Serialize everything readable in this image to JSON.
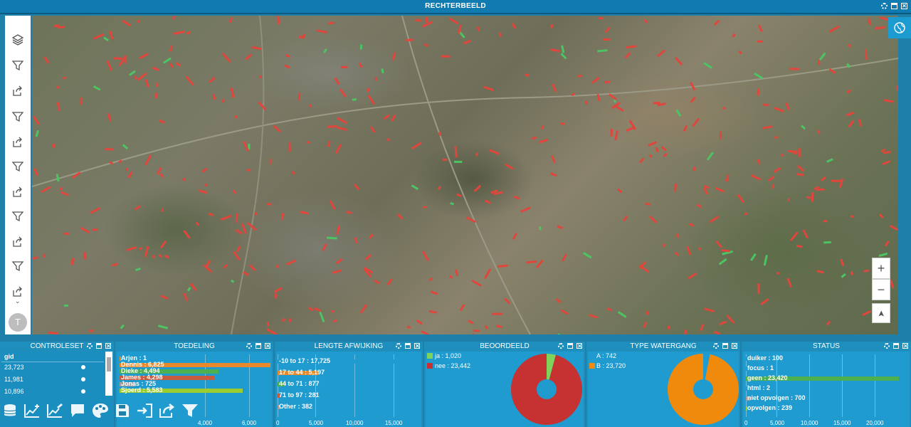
{
  "window": {
    "title": "RECHTERBEELD"
  },
  "sidebar": {
    "avatar_initial": "T"
  },
  "map": {
    "zoom_in": "+",
    "zoom_out": "−",
    "north": "➤"
  },
  "panels": {
    "controleset": {
      "title": "CONTROLESET",
      "column": "gid",
      "rows": [
        "23,723",
        "11,981",
        "10,896"
      ]
    },
    "toedeling": {
      "title": "TOEDELING",
      "rows": [
        {
          "label": "Arjen : 1",
          "value": 1,
          "color": "#e8892b"
        },
        {
          "label": "Dennis : 6,825",
          "value": 6825,
          "color": "#e8892b"
        },
        {
          "label": "Dieke : 4,494",
          "value": 4494,
          "color": "#4caf50"
        },
        {
          "label": "James : 4,298",
          "value": 4298,
          "color": "#c75b3f"
        },
        {
          "label": "Jonas : 725",
          "value": 725,
          "color": "#9e9e9e"
        },
        {
          "label": "Sjoerd : 5,583",
          "value": 5583,
          "color": "#9ccc2f"
        }
      ],
      "ticks": [
        "4,000",
        "6,000"
      ]
    },
    "lengte": {
      "title": "LENGTE AFWIJKING",
      "rows": [
        {
          "label": "-10 to 17 : 17,725",
          "value": 17725,
          "color": "#1f9bcf"
        },
        {
          "label": "17 to 44 : 5,197",
          "value": 5197,
          "color": "#e8892b"
        },
        {
          "label": "44 to 71 : 877",
          "value": 877,
          "color": "#4caf50"
        },
        {
          "label": "71 to 97 : 281",
          "value": 281,
          "color": "#c75b3f"
        },
        {
          "label": "Other : 382",
          "value": 382,
          "color": "#9e9e9e"
        }
      ],
      "ticks": [
        "0",
        "5,000",
        "10,000",
        "15,000"
      ]
    },
    "beoordeeld": {
      "title": "BEOORDEELD",
      "legend": [
        {
          "label": "ja : 1,020",
          "value": 1020,
          "color": "#7fd35a"
        },
        {
          "label": "nee : 23,442",
          "value": 23442,
          "color": "#c63232"
        }
      ]
    },
    "type": {
      "title": "TYPE WATERGANG",
      "legend": [
        {
          "label": "A : 742",
          "value": 742,
          "color": "#1f9bcf"
        },
        {
          "label": "B : 23,720",
          "value": 23720,
          "color": "#f08a0c"
        }
      ]
    },
    "status": {
      "title": "STATUS",
      "rows": [
        {
          "label": "duiker : 100",
          "value": 100,
          "color": "#1f9bcf"
        },
        {
          "label": "focus : 1",
          "value": 1,
          "color": "#1f9bcf"
        },
        {
          "label": "geen : 23,420",
          "value": 23420,
          "color": "#4caf50"
        },
        {
          "label": "html : 2",
          "value": 2,
          "color": "#1f9bcf"
        },
        {
          "label": "niet opvolgen : 700",
          "value": 700,
          "color": "#9e9e9e"
        },
        {
          "label": "opvolgen : 239",
          "value": 239,
          "color": "#9ccc2f"
        }
      ],
      "ticks": [
        "0",
        "5,000",
        "10,000",
        "15,000",
        "20,000"
      ]
    }
  },
  "colors": {
    "header": "#0f7bb0",
    "panel": "#1f9bcf",
    "red_segments": "#e0463c",
    "green_segments": "#4cc463"
  }
}
